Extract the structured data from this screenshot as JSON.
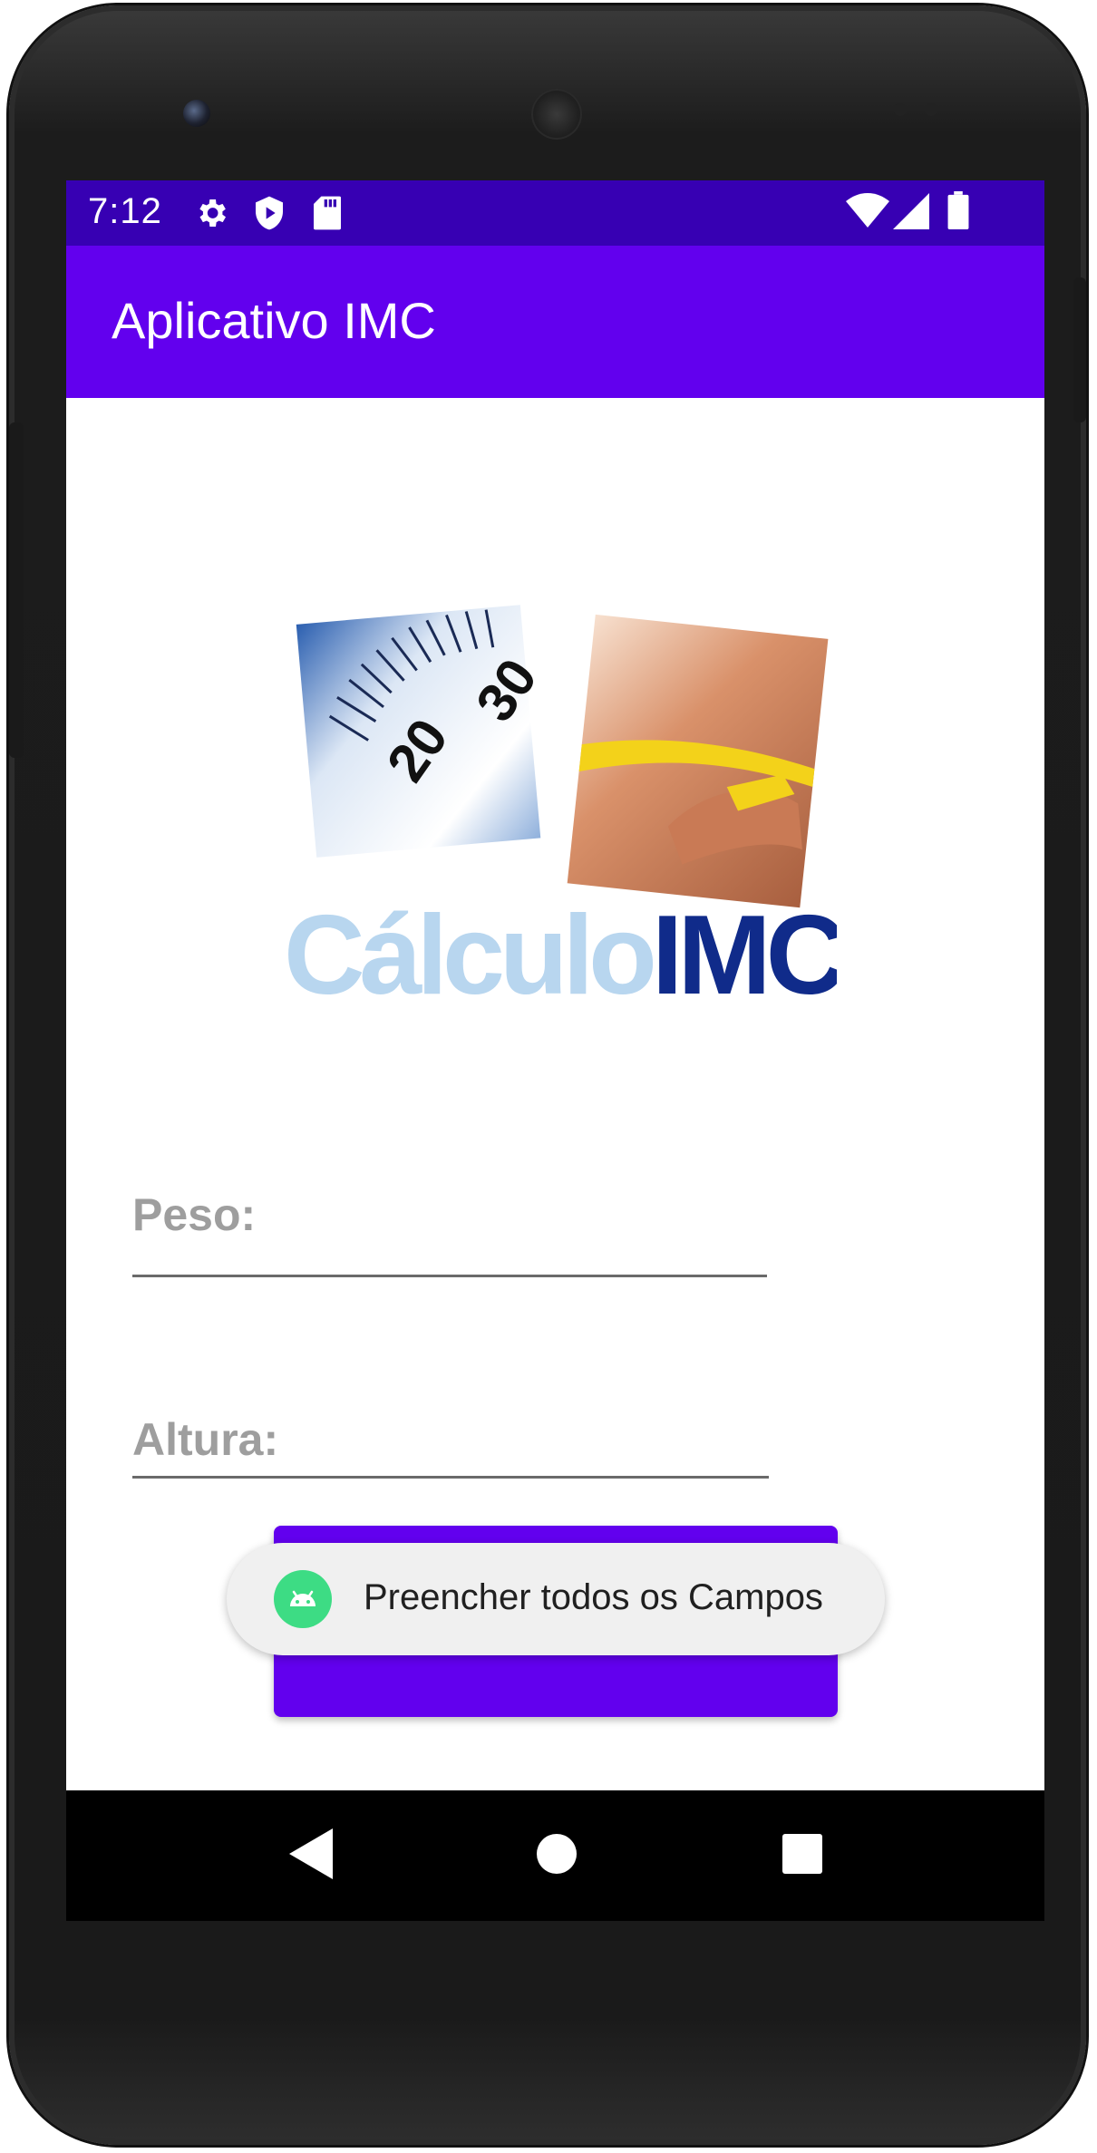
{
  "status_bar": {
    "time": "7:12",
    "left_icons": [
      "gear-icon",
      "shield-play-icon",
      "sd-card-icon"
    ],
    "right_icons": [
      "wifi-icon",
      "cell-signal-icon",
      "battery-icon"
    ]
  },
  "app_bar": {
    "title": "Aplicativo IMC"
  },
  "logo": {
    "text_light": "Cálculo",
    "text_dark": "IMC",
    "scale_numbers": [
      "20",
      "30"
    ]
  },
  "form": {
    "peso_hint": "Peso:",
    "altura_hint": "Altura:"
  },
  "toast": {
    "icon": "android-icon",
    "message": "Preencher todos os Campos"
  },
  "navigation": {
    "items": [
      "back-icon",
      "home-icon",
      "recents-icon"
    ]
  },
  "colors": {
    "status_bar": "#3700B3",
    "app_bar": "#6200EE",
    "button": "#6200EE",
    "hint": "#9e9e9e",
    "logo_light_text": "#b8d6ef",
    "logo_dark_text": "#102b8a",
    "toast_bg": "#f0f0f0",
    "android_green": "#3ddc84"
  }
}
